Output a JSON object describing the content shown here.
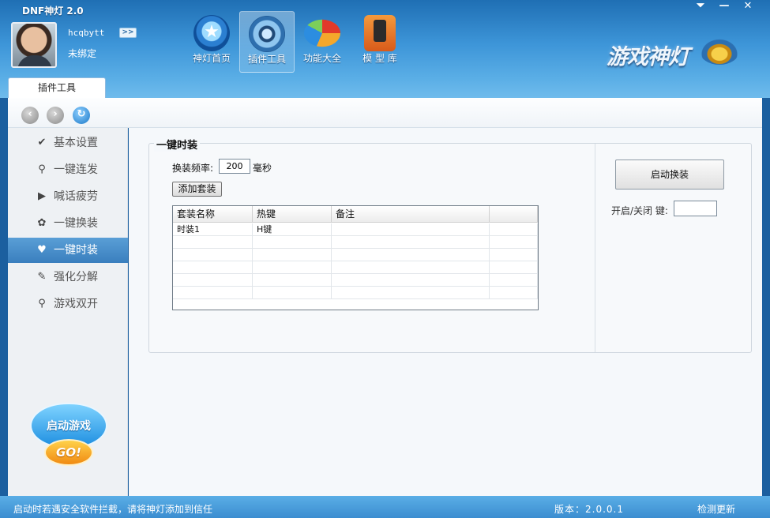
{
  "app": {
    "title": "DNF神灯 2.0"
  },
  "user": {
    "name": "hcqbytt",
    "bind_status": "未绑定",
    "expand_label": ">>"
  },
  "top_nav": [
    {
      "label": "神灯首页",
      "icon": "home-star-icon"
    },
    {
      "label": "插件工具",
      "icon": "plugin-tools-icon",
      "active": true
    },
    {
      "label": "功能大全",
      "icon": "features-pie-icon"
    },
    {
      "label": "模 型 库",
      "icon": "model-library-icon"
    }
  ],
  "logo": {
    "text": "游戏神灯"
  },
  "window_controls": {
    "menu": "⏷",
    "minimize": "—",
    "close": "✕"
  },
  "tab": {
    "label": "插件工具"
  },
  "toolbar": {
    "back": "‹",
    "forward": "›",
    "refresh": "↻"
  },
  "sidebar": {
    "items": [
      {
        "label": "基本设置",
        "icon": "✔",
        "icon_name": "check-icon"
      },
      {
        "label": "一键连发",
        "icon": "⚲",
        "icon_name": "search-icon"
      },
      {
        "label": "喊话疲劳",
        "icon": "▶",
        "icon_name": "arrow-right-icon"
      },
      {
        "label": "一键换装",
        "icon": "✿",
        "icon_name": "paw-icon"
      },
      {
        "label": "一键时装",
        "icon": "♥",
        "icon_name": "heart-icon",
        "active": true
      },
      {
        "label": "强化分解",
        "icon": "✎",
        "icon_name": "wrench-icon"
      },
      {
        "label": "游戏双开",
        "icon": "⚲",
        "icon_name": "search-icon"
      }
    ],
    "launch": {
      "label": "启动游戏",
      "go": "GO!"
    }
  },
  "panel": {
    "title": "一键时装",
    "freq_label": "换装频率:",
    "freq_value": "200",
    "freq_unit": "毫秒",
    "add_button": "添加套装",
    "table": {
      "columns": [
        "套装名称",
        "热键",
        "备注",
        ""
      ],
      "rows": [
        [
          "时装1",
          "H键",
          "",
          ""
        ]
      ]
    },
    "start_button": "启动换装",
    "toggle_key_label": "开启/关闭 键:",
    "toggle_key_value": ""
  },
  "status": {
    "hint": "启动时若遇安全软件拦截，请将神灯添加到信任",
    "version": "版本：2.0.0.1",
    "update": "检测更新"
  },
  "colors": {
    "accent": "#3a8fd4",
    "sidebar_active": "#4a8fcb"
  }
}
